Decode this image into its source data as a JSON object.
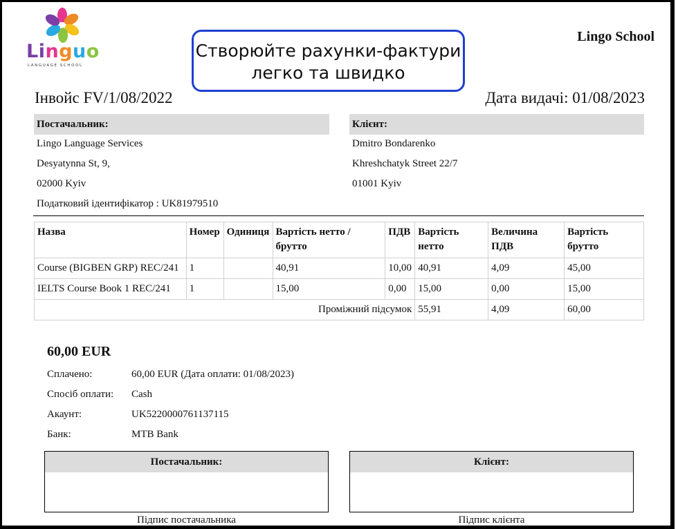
{
  "logo": {
    "word": "Linguo",
    "subtitle": "LANGUAGE SCHOOL"
  },
  "callout": {
    "text": "Створюйте рахунки-фактури легко та швидко"
  },
  "company": "Lingo School",
  "invoice": {
    "title": "Інвойс FV/1/08/2022",
    "issue_date": "Дата видачі: 01/08/2023"
  },
  "supplier": {
    "heading": "Постачальник:",
    "lines": [
      "Lingo Language Services",
      "Desyatynna St, 9,",
      "02000 Kyiv",
      "Податковий ідентифікатор : UK81979510"
    ]
  },
  "client": {
    "heading": "Клієнт:",
    "lines": [
      "Dmitro Bondarenko",
      "Khreshchatyk Street 22/7",
      "01001 Kyiv"
    ]
  },
  "table": {
    "headers": [
      "Назва",
      "Номер",
      "Одиниця",
      "Вартість нетто / брутто",
      "ПДВ",
      "Вартість нетто",
      "Величина ПДВ",
      "Вартість брутто"
    ],
    "rows": [
      [
        "Course (BIGBEN GRP) REC/241",
        "1",
        "",
        "40,91",
        "10,00",
        "40,91",
        "4,09",
        "45,00"
      ],
      [
        "IELTS Course Book 1 REC/241",
        "1",
        "",
        "15,00",
        "0,00",
        "15,00",
        "0,00",
        "15,00"
      ]
    ],
    "subtotal": {
      "label": "Проміжний підсумок",
      "net": "55,91",
      "vat": "4,09",
      "gross": "60,00"
    }
  },
  "summary": {
    "total": "60,00 EUR",
    "items": [
      {
        "label": "Сплачено:",
        "value": "60,00 EUR (Дата оплати: 01/08/2023)"
      },
      {
        "label": "Спосіб оплати:",
        "value": "Cash"
      },
      {
        "label": "Акаунт:",
        "value": "UK5220000761137115"
      },
      {
        "label": "Банк:",
        "value": "MTB Bank"
      }
    ]
  },
  "signatures": {
    "supplier": {
      "heading": "Постачальник:",
      "caption": "Підпис постачальника"
    },
    "client": {
      "heading": "Клієнт:",
      "caption": "Підпис клієнта"
    }
  },
  "colors": {
    "callout_border": "#1d3fd0",
    "header_bg": "#dcdcdc"
  }
}
